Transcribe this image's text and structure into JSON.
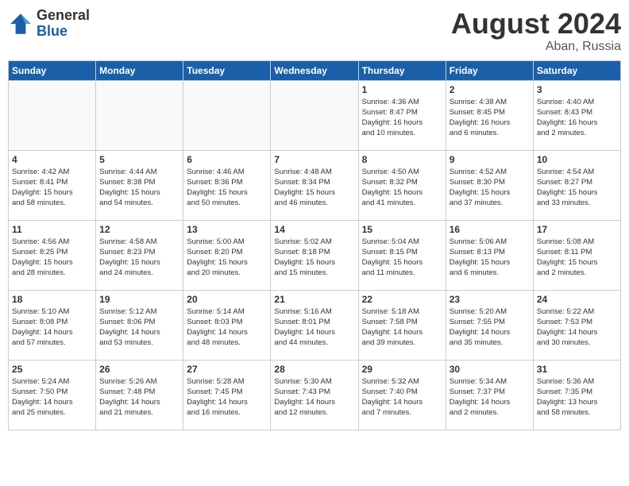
{
  "header": {
    "logo_general": "General",
    "logo_blue": "Blue",
    "month_year": "August 2024",
    "location": "Aban, Russia"
  },
  "weekdays": [
    "Sunday",
    "Monday",
    "Tuesday",
    "Wednesday",
    "Thursday",
    "Friday",
    "Saturday"
  ],
  "weeks": [
    [
      {
        "day": "",
        "info": ""
      },
      {
        "day": "",
        "info": ""
      },
      {
        "day": "",
        "info": ""
      },
      {
        "day": "",
        "info": ""
      },
      {
        "day": "1",
        "info": "Sunrise: 4:36 AM\nSunset: 8:47 PM\nDaylight: 16 hours\nand 10 minutes."
      },
      {
        "day": "2",
        "info": "Sunrise: 4:38 AM\nSunset: 8:45 PM\nDaylight: 16 hours\nand 6 minutes."
      },
      {
        "day": "3",
        "info": "Sunrise: 4:40 AM\nSunset: 8:43 PM\nDaylight: 16 hours\nand 2 minutes."
      }
    ],
    [
      {
        "day": "4",
        "info": "Sunrise: 4:42 AM\nSunset: 8:41 PM\nDaylight: 15 hours\nand 58 minutes."
      },
      {
        "day": "5",
        "info": "Sunrise: 4:44 AM\nSunset: 8:38 PM\nDaylight: 15 hours\nand 54 minutes."
      },
      {
        "day": "6",
        "info": "Sunrise: 4:46 AM\nSunset: 8:36 PM\nDaylight: 15 hours\nand 50 minutes."
      },
      {
        "day": "7",
        "info": "Sunrise: 4:48 AM\nSunset: 8:34 PM\nDaylight: 15 hours\nand 46 minutes."
      },
      {
        "day": "8",
        "info": "Sunrise: 4:50 AM\nSunset: 8:32 PM\nDaylight: 15 hours\nand 41 minutes."
      },
      {
        "day": "9",
        "info": "Sunrise: 4:52 AM\nSunset: 8:30 PM\nDaylight: 15 hours\nand 37 minutes."
      },
      {
        "day": "10",
        "info": "Sunrise: 4:54 AM\nSunset: 8:27 PM\nDaylight: 15 hours\nand 33 minutes."
      }
    ],
    [
      {
        "day": "11",
        "info": "Sunrise: 4:56 AM\nSunset: 8:25 PM\nDaylight: 15 hours\nand 28 minutes."
      },
      {
        "day": "12",
        "info": "Sunrise: 4:58 AM\nSunset: 8:23 PM\nDaylight: 15 hours\nand 24 minutes."
      },
      {
        "day": "13",
        "info": "Sunrise: 5:00 AM\nSunset: 8:20 PM\nDaylight: 15 hours\nand 20 minutes."
      },
      {
        "day": "14",
        "info": "Sunrise: 5:02 AM\nSunset: 8:18 PM\nDaylight: 15 hours\nand 15 minutes."
      },
      {
        "day": "15",
        "info": "Sunrise: 5:04 AM\nSunset: 8:15 PM\nDaylight: 15 hours\nand 11 minutes."
      },
      {
        "day": "16",
        "info": "Sunrise: 5:06 AM\nSunset: 8:13 PM\nDaylight: 15 hours\nand 6 minutes."
      },
      {
        "day": "17",
        "info": "Sunrise: 5:08 AM\nSunset: 8:11 PM\nDaylight: 15 hours\nand 2 minutes."
      }
    ],
    [
      {
        "day": "18",
        "info": "Sunrise: 5:10 AM\nSunset: 8:08 PM\nDaylight: 14 hours\nand 57 minutes."
      },
      {
        "day": "19",
        "info": "Sunrise: 5:12 AM\nSunset: 8:06 PM\nDaylight: 14 hours\nand 53 minutes."
      },
      {
        "day": "20",
        "info": "Sunrise: 5:14 AM\nSunset: 8:03 PM\nDaylight: 14 hours\nand 48 minutes."
      },
      {
        "day": "21",
        "info": "Sunrise: 5:16 AM\nSunset: 8:01 PM\nDaylight: 14 hours\nand 44 minutes."
      },
      {
        "day": "22",
        "info": "Sunrise: 5:18 AM\nSunset: 7:58 PM\nDaylight: 14 hours\nand 39 minutes."
      },
      {
        "day": "23",
        "info": "Sunrise: 5:20 AM\nSunset: 7:55 PM\nDaylight: 14 hours\nand 35 minutes."
      },
      {
        "day": "24",
        "info": "Sunrise: 5:22 AM\nSunset: 7:53 PM\nDaylight: 14 hours\nand 30 minutes."
      }
    ],
    [
      {
        "day": "25",
        "info": "Sunrise: 5:24 AM\nSunset: 7:50 PM\nDaylight: 14 hours\nand 25 minutes."
      },
      {
        "day": "26",
        "info": "Sunrise: 5:26 AM\nSunset: 7:48 PM\nDaylight: 14 hours\nand 21 minutes."
      },
      {
        "day": "27",
        "info": "Sunrise: 5:28 AM\nSunset: 7:45 PM\nDaylight: 14 hours\nand 16 minutes."
      },
      {
        "day": "28",
        "info": "Sunrise: 5:30 AM\nSunset: 7:43 PM\nDaylight: 14 hours\nand 12 minutes."
      },
      {
        "day": "29",
        "info": "Sunrise: 5:32 AM\nSunset: 7:40 PM\nDaylight: 14 hours\nand 7 minutes."
      },
      {
        "day": "30",
        "info": "Sunrise: 5:34 AM\nSunset: 7:37 PM\nDaylight: 14 hours\nand 2 minutes."
      },
      {
        "day": "31",
        "info": "Sunrise: 5:36 AM\nSunset: 7:35 PM\nDaylight: 13 hours\nand 58 minutes."
      }
    ]
  ]
}
